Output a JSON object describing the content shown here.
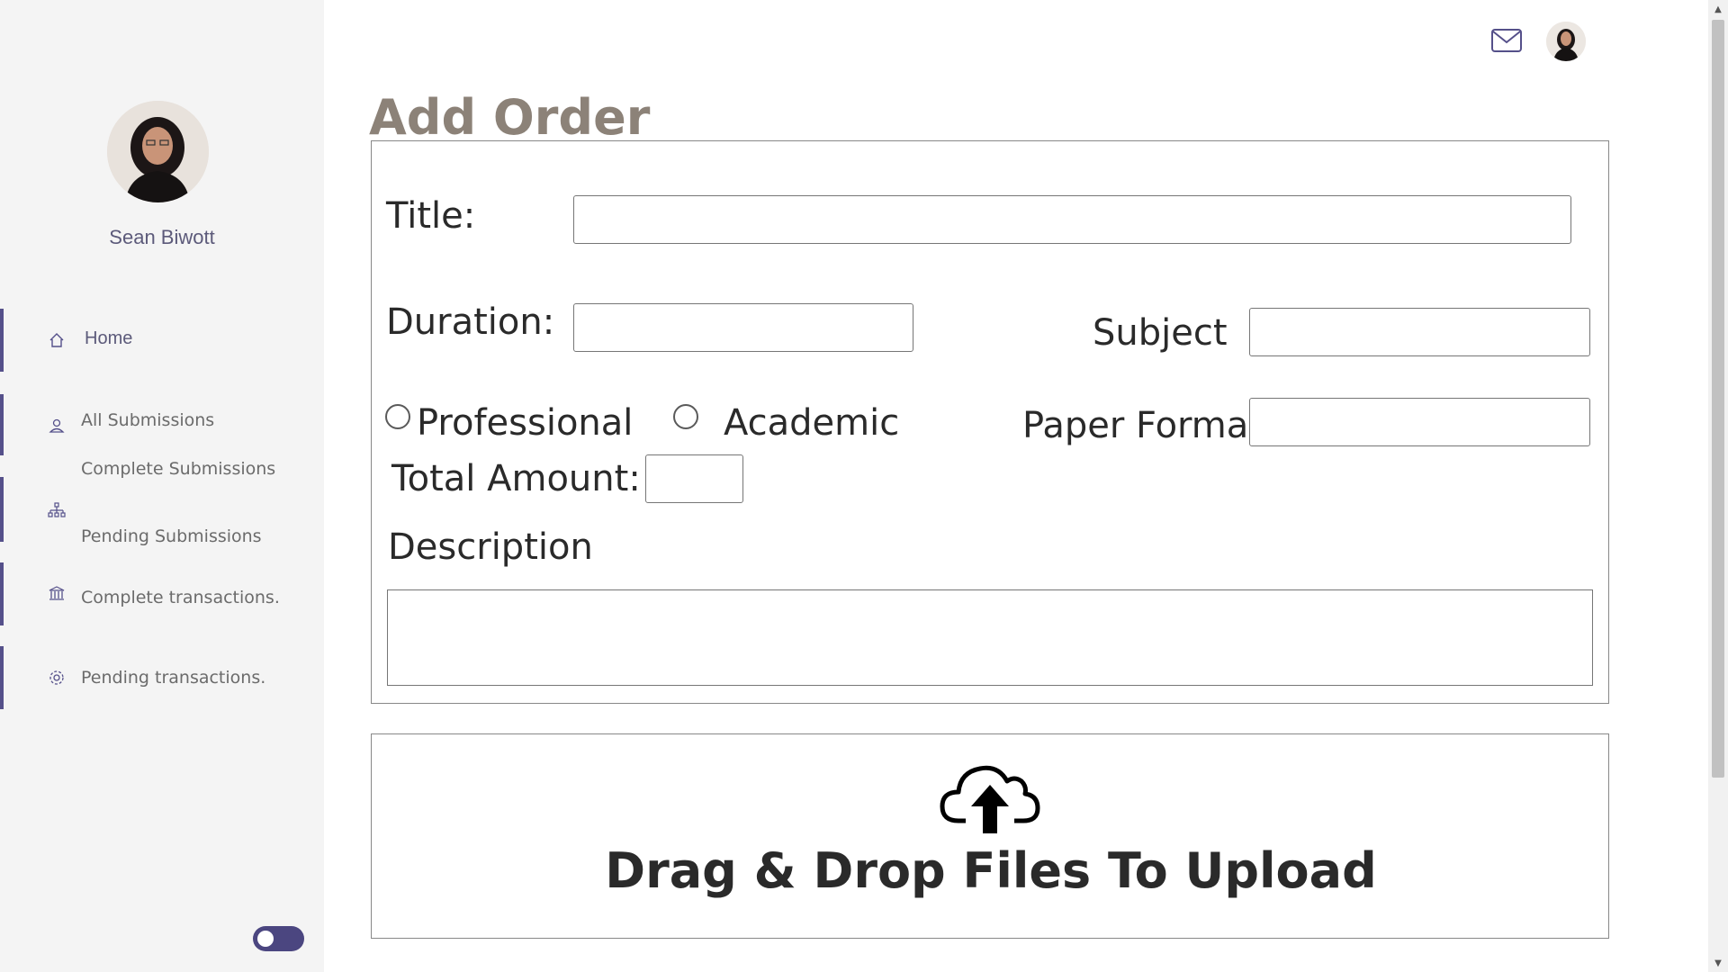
{
  "sidebar": {
    "profile": {
      "name": "Sean Biwott",
      "avatar_icon": "user-photo"
    },
    "items": [
      {
        "label": "Home",
        "icon": "home-icon"
      },
      {
        "label": "All Submissions",
        "icon": "user-icon"
      },
      {
        "label": "Complete Submissions",
        "icon": ""
      },
      {
        "label": "Pending Submissions",
        "icon": "sitemap-icon"
      },
      {
        "label": "Complete transactions.",
        "icon": "bank-icon"
      },
      {
        "label": "Pending transactions.",
        "icon": "gear-icon"
      }
    ],
    "theme_toggle": {
      "state": "off"
    }
  },
  "header": {
    "mail_icon": "mail-icon",
    "avatar_icon": "user-photo"
  },
  "main": {
    "title": "Add Order",
    "form": {
      "title_label": "Title:",
      "title_value": "",
      "duration_label": "Duration:",
      "duration_value": "",
      "subject_label": "Subject",
      "subject_value": "",
      "radio_professional": "Professional",
      "radio_academic": "Academic",
      "paper_format_label": "Paper Format",
      "paper_format_value": "",
      "total_amount_label": "Total Amount:",
      "total_amount_value": "",
      "description_label": "Description",
      "description_value": ""
    },
    "upload": {
      "text": "Drag & Drop Files To Upload",
      "icon": "cloud-upload-icon"
    }
  },
  "colors": {
    "accent": "#55508a",
    "title": "#8c8278",
    "sidebar_bg": "#f4f4f4"
  }
}
